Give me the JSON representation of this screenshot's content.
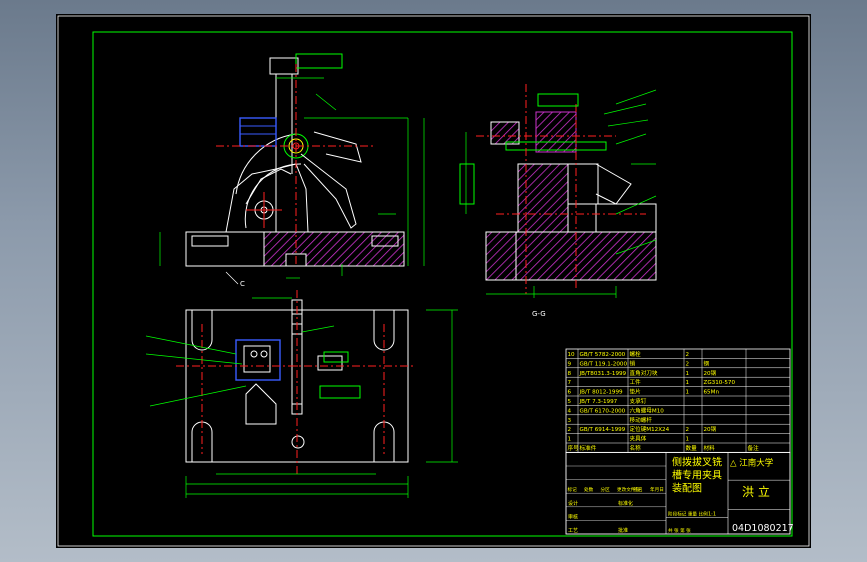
{
  "drawing": {
    "section_label": "G-G",
    "view_label_c": "C",
    "university": "江南大学",
    "title_lines": [
      "侧拨拔叉铣",
      "槽专用夹具",
      "装配图"
    ],
    "designer_name": "洪 立",
    "drawing_number": "04D1080217",
    "scale": "1:1"
  },
  "bom": [
    {
      "no": "10",
      "std": "GB/T 5782-2000",
      "name": "螺栓",
      "qty": "2",
      "material": "",
      "note": ""
    },
    {
      "no": "9",
      "std": "GB/T 119.1-2000",
      "name": "销",
      "qty": "2",
      "material": "钢",
      "note": ""
    },
    {
      "no": "8",
      "std": "JB/T8031.3-1999",
      "name": "直角对刀块",
      "qty": "1",
      "material": "20钢",
      "note": ""
    },
    {
      "no": "7",
      "std": "",
      "name": "工件",
      "qty": "1",
      "material": "ZG310-570",
      "note": ""
    },
    {
      "no": "6",
      "std": "JB/T 8012-1999",
      "name": "垫片",
      "qty": "1",
      "material": "65Mn",
      "note": ""
    },
    {
      "no": "5",
      "std": "JB/T 7.3-1997",
      "name": "支承钉",
      "qty": "",
      "material": "",
      "note": ""
    },
    {
      "no": "4",
      "std": "GB/T 6170-2000",
      "name": "六角螺母M10",
      "qty": "",
      "material": "",
      "note": ""
    },
    {
      "no": "3",
      "std": "",
      "name": "移动螺杆",
      "qty": "",
      "material": "",
      "note": ""
    },
    {
      "no": "2",
      "std": "GB/T 6914-1999",
      "name": "定位键M12X24",
      "qty": "2",
      "material": "20钢",
      "note": ""
    },
    {
      "no": "1",
      "std": "",
      "name": "夹具体",
      "qty": "1",
      "material": "",
      "note": ""
    }
  ],
  "bom_header": [
    "序号",
    "标准件",
    "名称",
    "数量",
    "材料",
    "备注"
  ],
  "title_block": {
    "row_labels": [
      "标记",
      "处数",
      "分区",
      "更改文件号",
      "签名",
      "年月日"
    ],
    "design_label": "设计",
    "standard_label": "标准化",
    "review_label": "审核",
    "process_label": "工艺",
    "approve_label": "批准",
    "stage_label": "阶段标记",
    "weight_label": "重量",
    "scale_label": "比例",
    "sheet_label": "共 张 第 张"
  },
  "colors": {
    "border": "#00ff00",
    "outline": "#ffffff",
    "hatch": "#cc33cc",
    "center": "#ff2020",
    "dim": "#00ff00",
    "text": "#ffff00",
    "blue": "#3a5cff",
    "cyan": "#00e0ff"
  }
}
